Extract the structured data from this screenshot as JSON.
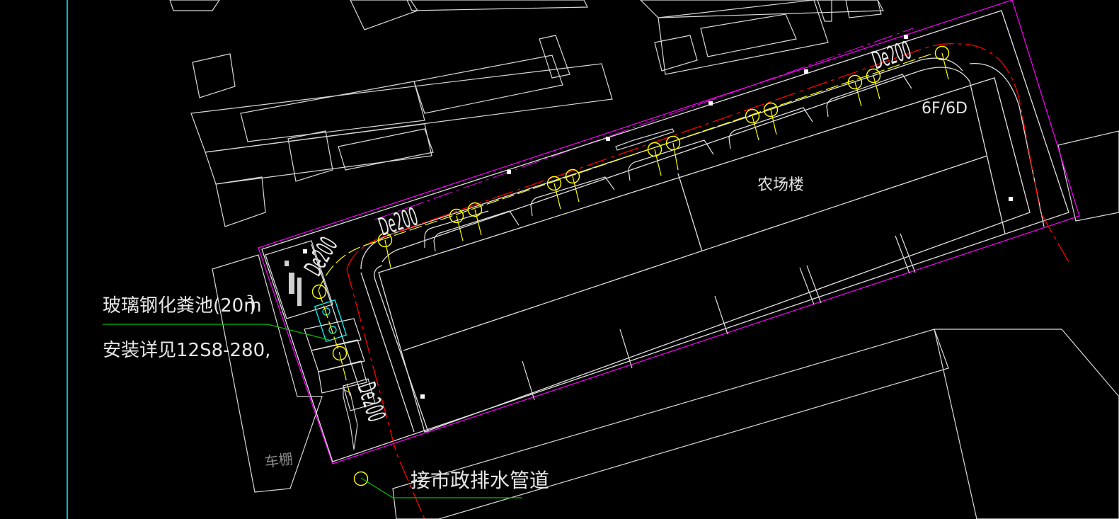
{
  "colors": {
    "background": "#000000",
    "building_outline": "#e6e6e6",
    "property_line": "#ff00ff",
    "sewer_line": "#ff0000",
    "drain_line": "#ffff00",
    "manhole": "#ffff00",
    "leader": "#00c000",
    "border": "#00ffff",
    "septic_tank": "#00ffff",
    "dim_text": "#7f7f7f"
  },
  "labels": {
    "building_name": "农场楼",
    "floor_info": "6F/6D",
    "septic_tank_line1": "玻璃钢化粪池(20m",
    "septic_tank_sup": "3",
    "septic_tank_close": ")",
    "septic_tank_line2": "安装详见12S8-280,",
    "connect_note": "接市政排水管道",
    "carport": "车棚",
    "pipe_size_1": "De200",
    "pipe_size_2": "De200",
    "pipe_size_3": "De200",
    "pipe_size_4": "De200"
  },
  "icons": {
    "manhole": "circle-manhole-icon",
    "septic_tank": "septic-tank-icon",
    "flow_arrow": "flow-arrow-icon"
  }
}
